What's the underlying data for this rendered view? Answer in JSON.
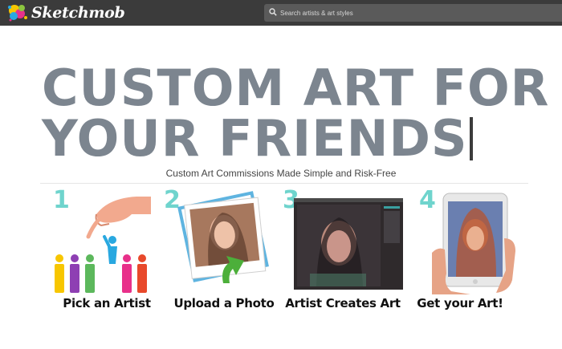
{
  "header": {
    "logo_text": "Sketchmob",
    "search_placeholder": "Search artists & art styles"
  },
  "hero": {
    "headline_line1": "CUSTOM ART FOR",
    "headline_line2": "YOUR FRIENDS",
    "subtitle": "Custom Art Commissions Made Simple and Risk-Free"
  },
  "steps": [
    {
      "number": "1",
      "caption": "Pick an Artist"
    },
    {
      "number": "2",
      "caption": "Upload a Photo"
    },
    {
      "number": "3",
      "caption": "Artist Creates Art"
    },
    {
      "number": "4",
      "caption": "Get your Art!"
    }
  ],
  "colors": {
    "topbar": "#3b3b3b",
    "headline": "#7c858f",
    "step_number": "#6fd4cd"
  }
}
